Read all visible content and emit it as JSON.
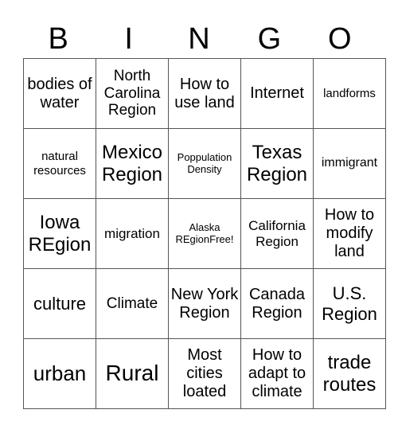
{
  "header": {
    "letters": [
      "B",
      "I",
      "N",
      "G",
      "O"
    ]
  },
  "grid": {
    "rows": [
      [
        "bodies of water",
        "North Carolina Region",
        "How to use land",
        "Internet",
        "landforms"
      ],
      [
        "natural resources",
        "Mexico Region",
        "Poppulation Density",
        "Texas Region",
        "immigrant"
      ],
      [
        "Iowa REgion",
        "migration",
        "Alaska REgionFree!",
        "California Region",
        "How to modify land"
      ],
      [
        "culture",
        "Climate",
        "New York Region",
        "Canada Region",
        "U.S. Region"
      ],
      [
        "urban",
        "Rural",
        "Most cities loated",
        "How to adapt to climate",
        "trade routes"
      ]
    ]
  }
}
